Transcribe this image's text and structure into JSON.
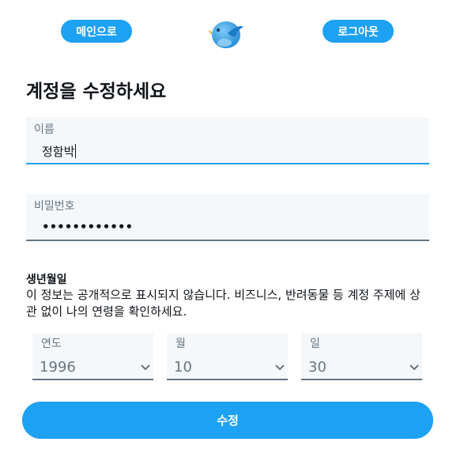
{
  "header": {
    "main_label": "메인으로",
    "logout_label": "로그아웃",
    "logo_icon": "bird-icon"
  },
  "title": "계정을 수정하세요",
  "name_field": {
    "label": "이름",
    "value": "정함박"
  },
  "password_field": {
    "label": "비밀번호",
    "value": "••••••••••••"
  },
  "birth": {
    "title": "생년월일",
    "description": "이 정보는 공개적으로 표시되지 않습니다. 비즈니스, 반려동물 등 계정 주제에 상관 없이 나의 연령을 확인하세요.",
    "year": {
      "label": "연도",
      "value": "1996"
    },
    "month": {
      "label": "월",
      "value": "10"
    },
    "day": {
      "label": "일",
      "value": "30"
    }
  },
  "submit_label": "수정",
  "colors": {
    "accent": "#1da1f2",
    "field_bg": "#f5f8fa",
    "muted_text": "#657786"
  }
}
